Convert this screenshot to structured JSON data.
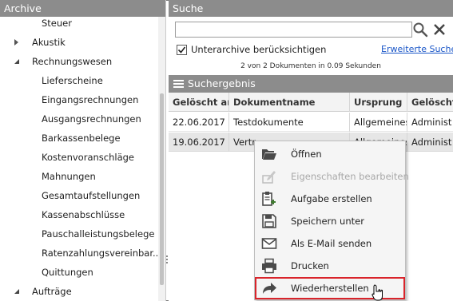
{
  "left_panel": {
    "title": "Archive",
    "tree": [
      {
        "label": "Steuer",
        "indent": 2,
        "toggle": "none"
      },
      {
        "label": "Akustik",
        "indent": 1,
        "toggle": "collapsed"
      },
      {
        "label": "Rechnungswesen",
        "indent": 1,
        "toggle": "expanded"
      },
      {
        "label": "Lieferscheine",
        "indent": 2,
        "toggle": "none"
      },
      {
        "label": "Eingangsrechnungen",
        "indent": 2,
        "toggle": "none"
      },
      {
        "label": "Ausgangsrechnungen",
        "indent": 2,
        "toggle": "none"
      },
      {
        "label": "Barkassenbelege",
        "indent": 2,
        "toggle": "none"
      },
      {
        "label": "Kostenvoranschläge",
        "indent": 2,
        "toggle": "none"
      },
      {
        "label": "Mahnungen",
        "indent": 2,
        "toggle": "none"
      },
      {
        "label": "Gesamtaufstellungen",
        "indent": 2,
        "toggle": "none"
      },
      {
        "label": "Kassenabschlüsse",
        "indent": 2,
        "toggle": "none"
      },
      {
        "label": "Pauschalleistungsbelege",
        "indent": 2,
        "toggle": "none"
      },
      {
        "label": "Ratenzahlungsvereinbar...",
        "indent": 2,
        "toggle": "none"
      },
      {
        "label": "Quittungen",
        "indent": 2,
        "toggle": "none"
      },
      {
        "label": "Aufträge",
        "indent": 1,
        "toggle": "expanded"
      }
    ]
  },
  "search": {
    "title": "Suche",
    "query": "",
    "include_subarchives_label": "Unterarchive berücksichtigen",
    "include_subarchives_checked": true,
    "advanced_link": "Erweiterte Suche",
    "result_info": "2 von 2 Dokumenten in 0.09 Sekunden"
  },
  "results": {
    "title": "Suchergebnis",
    "columns": [
      "Gelöscht am",
      "Dokumentname",
      "Ursprung",
      "Gelöscht"
    ],
    "rows": [
      [
        "22.06.2017",
        "Testdokumente",
        "Allgemeines",
        "Administ"
      ],
      [
        "19.06.2017",
        "Vertr",
        "Allgemeines",
        "Administ"
      ]
    ]
  },
  "context_menu": {
    "items": [
      {
        "label": "Öffnen",
        "icon": "folder-open-icon",
        "disabled": false
      },
      {
        "label": "Eigenschaften bearbeiten",
        "icon": "edit-properties-icon",
        "disabled": true
      },
      {
        "label": "Aufgabe erstellen",
        "icon": "create-task-icon",
        "disabled": false
      },
      {
        "label": "Speichern unter",
        "icon": "save-icon",
        "disabled": false
      },
      {
        "label": "Als E-Mail senden",
        "icon": "mail-icon",
        "disabled": false
      },
      {
        "label": "Drucken",
        "icon": "printer-icon",
        "disabled": false
      },
      {
        "label": "Wiederherstellen",
        "icon": "restore-arrow-icon",
        "disabled": false,
        "highlighted": true
      }
    ]
  },
  "colors": {
    "header_bg": "#8c8c8c",
    "link": "#1a56c8",
    "highlight_border": "#d9242b"
  }
}
